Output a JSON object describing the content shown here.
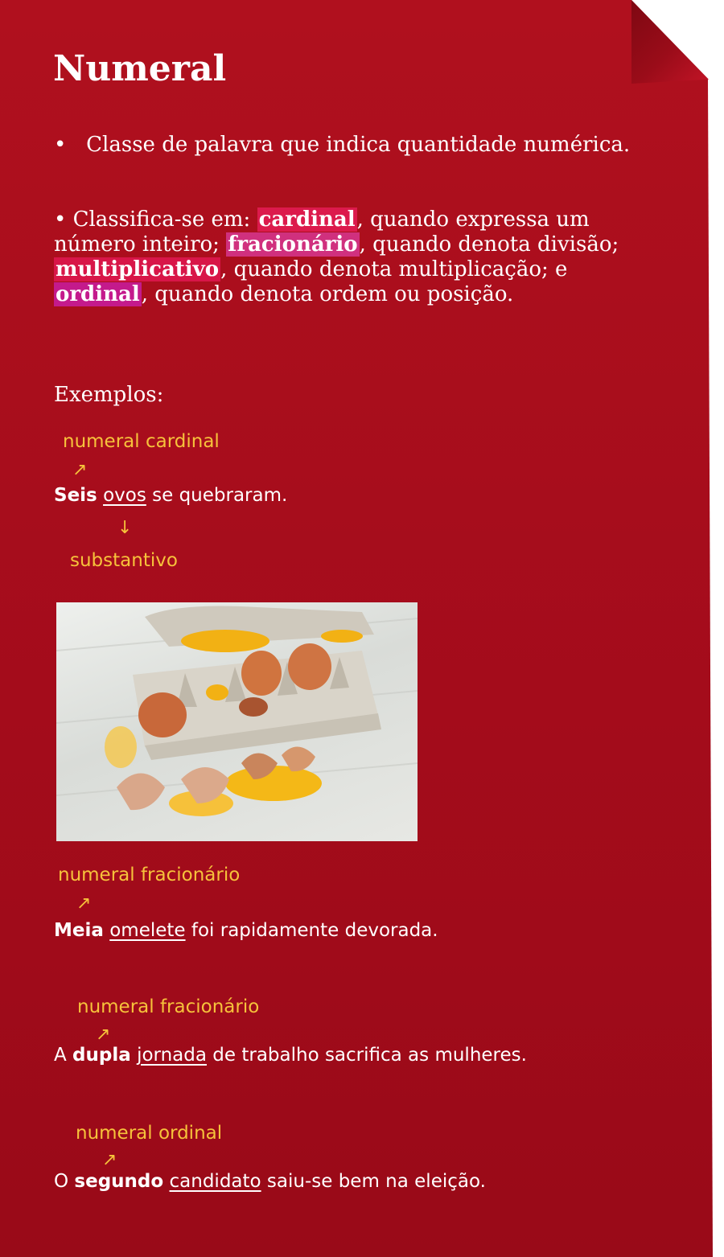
{
  "title": "Numeral",
  "definition": {
    "bullet": "•",
    "text": "Classe de palavra que indica quantidade numérica."
  },
  "classification": {
    "lead": "• Classifica-se em: ",
    "cardinal": "cardinal",
    "after_cardinal": ", quando expressa um número inteiro; ",
    "fracionario": "fracionário",
    "after_fracionario": ", quando denota divisão; ",
    "multiplicativo": "multiplicativo",
    "after_multiplicativo": ", quando denota multiplicação; e ",
    "ordinal": "ordinal",
    "after_ordinal": ", quando denota ordem ou posição."
  },
  "examples_label": "Exemplos:",
  "examples": [
    {
      "annotation_top": "numeral cardinal",
      "numeral": "Seis",
      "space1": " ",
      "noun": "ovos",
      "rest": " se quebraram.",
      "annotation_bottom": "substantivo"
    },
    {
      "annotation_top": "numeral fracionário",
      "numeral": "Meia",
      "space1": " ",
      "noun": "omelete",
      "rest": " foi rapidamente devorada."
    },
    {
      "annotation_top": "numeral fracionário",
      "prefix": "A ",
      "numeral": "dupla",
      "space1": " ",
      "noun": "jornada",
      "rest": " de trabalho sacrifica as mulheres."
    },
    {
      "annotation_top": "numeral ordinal",
      "prefix": "O ",
      "numeral": "segundo",
      "space1": " ",
      "noun": "candidato",
      "rest": " saiu-se bem na eleição."
    }
  ],
  "colors": {
    "paper": "#a70d1c",
    "annotation": "#f6c23b",
    "highlight_cardinal": "#dc1a4c",
    "highlight_fracionario": "#d0307e",
    "highlight_multiplicativo": "#d81648",
    "highlight_ordinal": "#c41a8c"
  }
}
